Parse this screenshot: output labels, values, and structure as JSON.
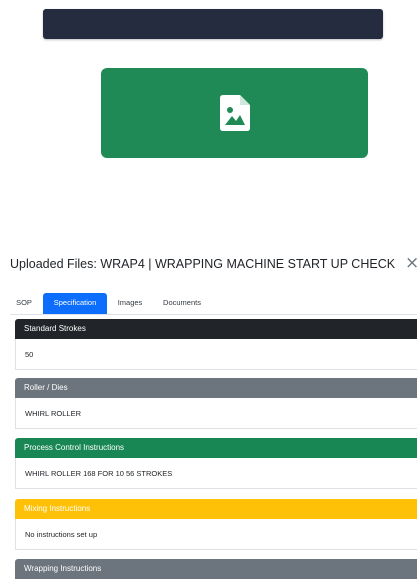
{
  "modal": {
    "title": "Uploaded Files: WRAP4 | WRAPPING MACHINE START UP CHECK",
    "close_symbol": "×"
  },
  "file_tile": {
    "icon": "file-image-icon",
    "color": "#1f8a55"
  },
  "tabs": [
    {
      "label": "SOP",
      "active": false
    },
    {
      "label": "Specification",
      "active": true
    },
    {
      "label": "Images",
      "active": false
    },
    {
      "label": "Documents",
      "active": false
    }
  ],
  "sections": [
    {
      "header": "Standard Strokes",
      "body": "50",
      "color": "#212529"
    },
    {
      "header": "Roller / Dies",
      "body": "WHIRL ROLLER",
      "color": "#6c757d"
    },
    {
      "header": "Process Control Instructions",
      "body": "WHIRL ROLLER 168 FOR 10 56 STROKES",
      "color": "#198754"
    },
    {
      "header": "Mixing Instructions",
      "body": "No instructions set up",
      "color": "#ffc107"
    },
    {
      "header": "Wrapping Instructions",
      "body": "",
      "color": "#6c757d"
    }
  ]
}
